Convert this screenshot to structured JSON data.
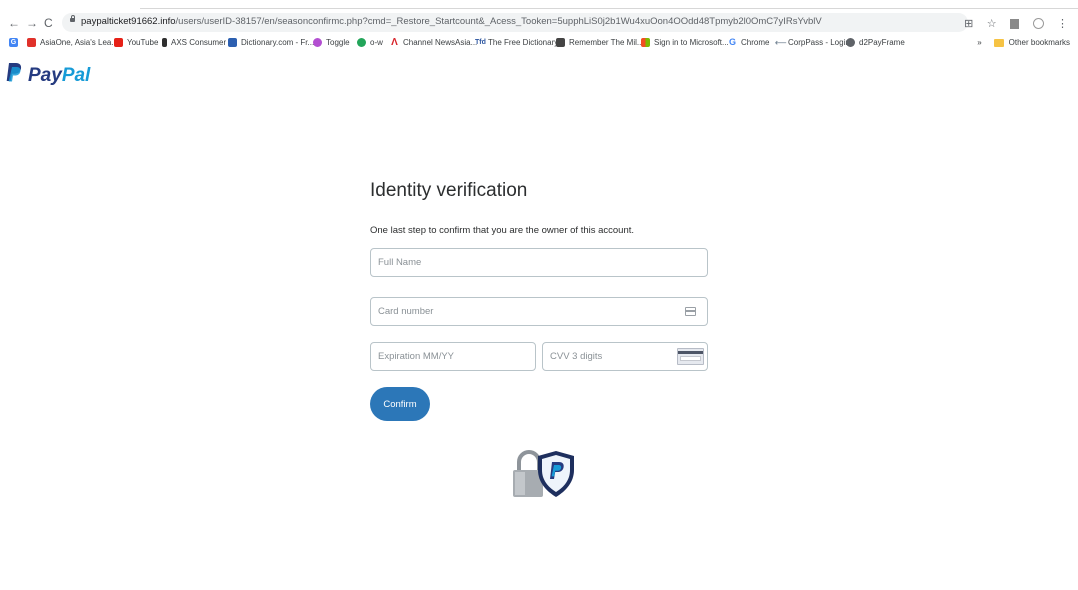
{
  "browser": {
    "url_host": "paypalticket91662.info",
    "url_path": "/users/userID-38157/en/seasonconfirmc.php?cmd=_Restore_Startcount&_Acess_Tooken=5upphLiS0j2b1Wu4xuOon4OOdd48Tpmyb2l0OmC7yIRsYvblV",
    "bookmarks": [
      {
        "label": "AsiaOne, Asia's Lea...",
        "icon": "asiaone-icon",
        "color": "#e0312a"
      },
      {
        "label": "YouTube",
        "icon": "youtube-icon",
        "color": "#e62117"
      },
      {
        "label": "AXS Consumer",
        "icon": "axs-icon",
        "color": "#2f2f2f"
      },
      {
        "label": "Dictionary.com - Fr...",
        "icon": "dictionary-icon",
        "color": "#2c5fb0"
      },
      {
        "label": "Toggle",
        "icon": "toggle-icon",
        "color": "#b34fd1"
      },
      {
        "label": "o-w",
        "icon": "ow-icon",
        "color": "#23a55a"
      },
      {
        "label": "Channel NewsAsia...",
        "icon": "cna-icon",
        "color": "#d8232a"
      },
      {
        "label": "The Free Dictionary",
        "icon": "tfd-icon",
        "color": "#2d56a0"
      },
      {
        "label": "Remember The Mil...",
        "icon": "rtm-icon",
        "color": "#444444"
      },
      {
        "label": "Sign in to Microsoft...",
        "icon": "microsoft-icon",
        "color": "#f25022"
      },
      {
        "label": "Chrome",
        "icon": "google-icon",
        "color": "#4285f4"
      },
      {
        "label": "CorpPass - Login",
        "icon": "corppass-icon",
        "color": "#7a8a99"
      },
      {
        "label": "d2PayFrame",
        "icon": "globe-icon",
        "color": "#5f6368"
      }
    ],
    "other_bookmarks": "Other bookmarks",
    "more_bookmarks": "»"
  },
  "logo": {
    "pay": "Pay",
    "pal": "Pal",
    "p": "P"
  },
  "form": {
    "title": "Identity verification",
    "subtitle": "One last step to confirm that you are the owner of this account.",
    "fullname_placeholder": "Full Name",
    "cardnumber_placeholder": "Card number",
    "expiry_placeholder": "Expiration MM/YY",
    "cvv_placeholder": "CVV 3 digits",
    "confirm_label": "Confirm"
  },
  "colors": {
    "paypal_dark": "#253b80",
    "paypal_light": "#179bd7",
    "button": "#2c77b8"
  }
}
